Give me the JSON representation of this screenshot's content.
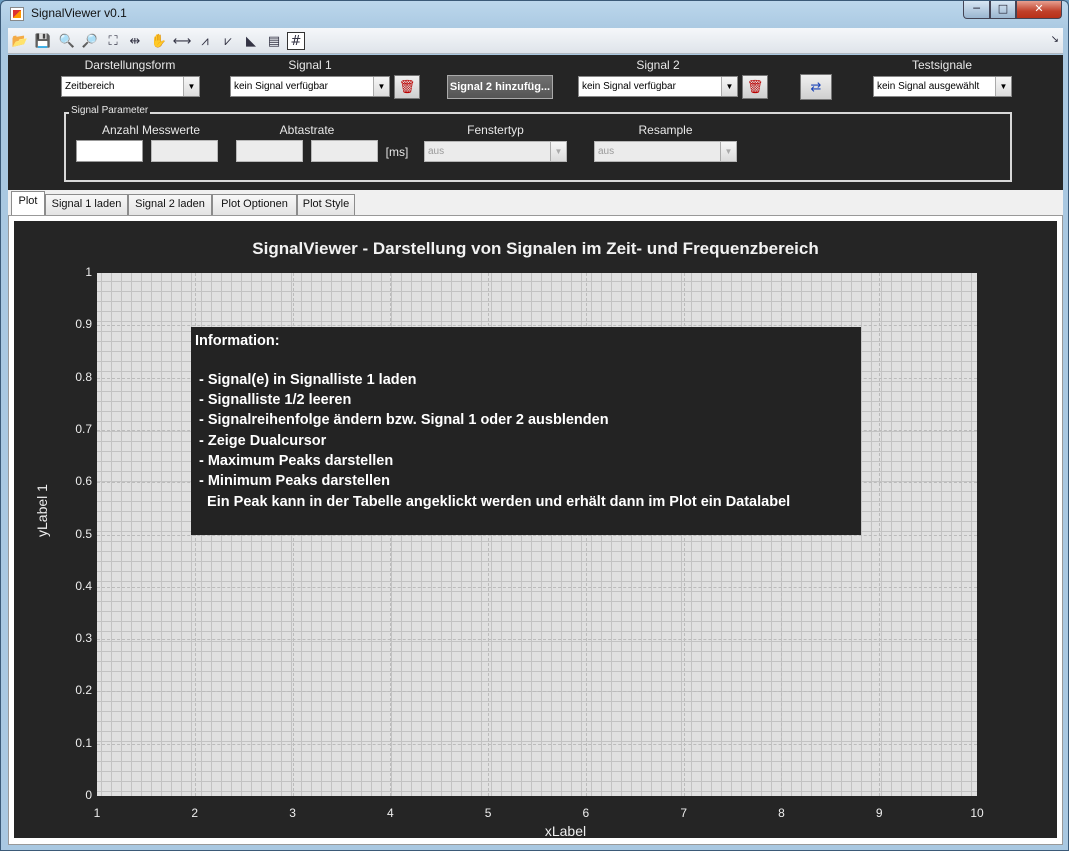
{
  "window": {
    "title": "SignalViewer v0.1",
    "min": "─",
    "max": "□",
    "close": "✕"
  },
  "toolbar": {
    "tools": [
      {
        "name": "open-icon",
        "glyph": "📂"
      },
      {
        "name": "save-icon",
        "glyph": "💾"
      },
      {
        "name": "zoom-in-icon",
        "glyph": "🔍"
      },
      {
        "name": "zoom-out-icon",
        "glyph": "🔎"
      },
      {
        "name": "zoom-fit-icon",
        "glyph": "⛶"
      },
      {
        "name": "measure-icon",
        "glyph": "⇹"
      },
      {
        "name": "pan-icon",
        "glyph": "✋"
      },
      {
        "name": "cursor-icon",
        "glyph": "⟷"
      },
      {
        "name": "peak-max-icon",
        "glyph": "⩘"
      },
      {
        "name": "peak-min-icon",
        "glyph": "⩗"
      },
      {
        "name": "datatip-icon",
        "glyph": "◣"
      },
      {
        "name": "legend-icon",
        "glyph": "▤"
      },
      {
        "name": "grid-icon",
        "glyph": "#"
      }
    ],
    "overflow": "↘"
  },
  "controls": {
    "darstellungsform_label": "Darstellungsform",
    "darstellungsform_value": "Zeitbereich",
    "signal1_label": "Signal 1",
    "signal1_value": "kein Signal verfügbar",
    "add_signal2": "Signal 2 hinzufüg...",
    "signal2_label": "Signal 2",
    "signal2_value": "kein Signal verfügbar",
    "testsignale_label": "Testsignale",
    "testsignale_value": "kein Signal ausgewählt"
  },
  "params": {
    "title": "Signal Parameter",
    "anzahl_label": "Anzahl Messwerte",
    "abtastrate_label": "Abtastrate",
    "unit": "[ms]",
    "fenstertyp_label": "Fenstertyp",
    "fenstertyp_value": "aus",
    "resample_label": "Resample",
    "resample_value": "aus"
  },
  "tabs": [
    "Plot",
    "Signal 1 laden",
    "Signal 2 laden",
    "Plot Optionen",
    "Plot Style"
  ],
  "info": {
    "title": "Information:",
    "lines": [
      "- Signal(e) in Signalliste 1 laden",
      "- Signalliste 1/2 leeren",
      "- Signalreihenfolge ändern bzw. Signal 1 oder 2 ausblenden",
      "- Zeige Dualcursor",
      "- Maximum Peaks darstellen",
      "- Minimum Peaks darstellen",
      "  Ein Peak kann in der Tabelle angeklickt werden und erhält dann im Plot ein Datalabel"
    ]
  },
  "colors": {
    "background": "#252525",
    "axes": "#e0e0e0",
    "text": "#eeeeee"
  },
  "chart_data": {
    "type": "line",
    "title": "SignalViewer - Darstellung von Signalen im Zeit- und Frequenzbereich",
    "xlabel": "xLabel",
    "ylabel": "yLabel 1",
    "xlim": [
      1,
      10
    ],
    "ylim": [
      0,
      1
    ],
    "xticks": [
      "1",
      "2",
      "3",
      "4",
      "5",
      "6",
      "7",
      "8",
      "9",
      "10"
    ],
    "yticks": [
      "0",
      "0.1",
      "0.2",
      "0.3",
      "0.4",
      "0.5",
      "0.6",
      "0.7",
      "0.8",
      "0.9",
      "1"
    ],
    "grid": true,
    "series": []
  }
}
